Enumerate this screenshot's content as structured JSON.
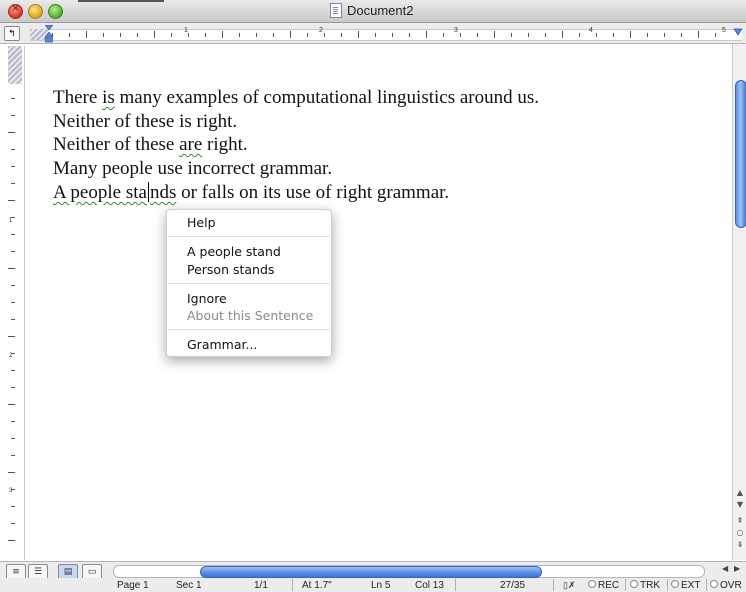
{
  "window": {
    "title": "Document2"
  },
  "ruler": {
    "numbers": [
      "1",
      "2",
      "3",
      "4",
      "5"
    ],
    "vertical_numbers": [
      "1",
      "2",
      "3"
    ]
  },
  "document": {
    "lines": [
      "There is many examples of computational linguistics around us.",
      "Neither of these is right.",
      "Neither of these are right.",
      "Many people use incorrect grammar.",
      "A people stands or falls on its use of right grammar."
    ]
  },
  "context_menu": {
    "help": "Help",
    "suggestion_1": "A people stand",
    "suggestion_2": "Person stands",
    "ignore": "Ignore",
    "about": "About this Sentence",
    "grammar": "Grammar..."
  },
  "status_bar": {
    "page": "Page 1",
    "section": "Sec 1",
    "page_count": "1/1",
    "at": "At 1.7\"",
    "line": "Ln 5",
    "column": "Col 13",
    "words": "27/35",
    "rec": "REC",
    "trk": "TRK",
    "ext": "EXT",
    "ovr": "OVR"
  },
  "colors": {
    "grammar_underline": "#2a8a2a",
    "scroll_thumb": "#5d8fe0"
  }
}
